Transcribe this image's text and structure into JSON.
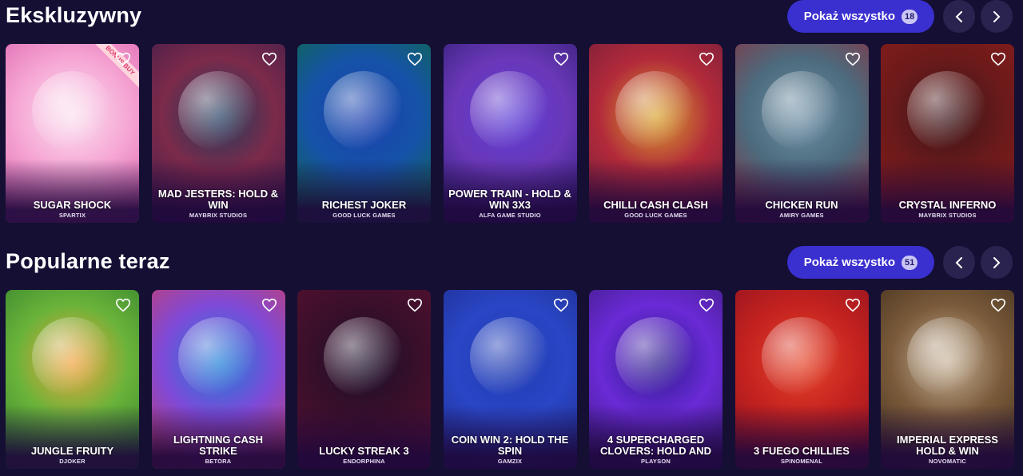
{
  "sections": [
    {
      "title": "Ekskluzywny",
      "show_all_label": "Pokaż wszystko",
      "count": "18",
      "games": [
        {
          "title": "SUGAR SHOCK",
          "provider": "SPARTIX",
          "badge": "BONUS BUY",
          "colors": [
            "#fbe1f0",
            "#f6a6d4",
            "#d85aa8"
          ]
        },
        {
          "title": "MAD JESTERS: HOLD & WIN",
          "provider": "MAYBRIX STUDIOS",
          "colors": [
            "#1e3d5e",
            "#7c2a4a",
            "#3a1b4a"
          ]
        },
        {
          "title": "RICHEST JOKER",
          "provider": "GOOD LUCK GAMES",
          "colors": [
            "#1b3fb0",
            "#1553a8",
            "#0e6b3a"
          ]
        },
        {
          "title": "POWER TRAIN - HOLD & WIN 3X3",
          "provider": "ALFA GAME STUDIO",
          "colors": [
            "#5b3bd6",
            "#6a38b8",
            "#2a1a6b"
          ]
        },
        {
          "title": "CHILLI CASH CLASH",
          "provider": "GOOD LUCK GAMES",
          "colors": [
            "#d9a52e",
            "#b22a3a",
            "#6a1b3a"
          ]
        },
        {
          "title": "CHICKEN RUN",
          "provider": "AMIRY GAMES",
          "colors": [
            "#6e8fa6",
            "#4c6b7d",
            "#8d2a3a"
          ]
        },
        {
          "title": "CRYSTAL INFERNO",
          "provider": "MAYBRIX STUDIOS",
          "colors": [
            "#3a1518",
            "#6a1a1a",
            "#8e1c1c"
          ]
        }
      ]
    },
    {
      "title": "Popularne teraz",
      "show_all_label": "Pokaż wszystko",
      "count": "51",
      "games": [
        {
          "title": "JUNGLE FRUITY",
          "provider": "DJOKER",
          "colors": [
            "#f3a23c",
            "#6ab33a",
            "#2b7a2b"
          ]
        },
        {
          "title": "LIGHTNING CASH STRIKE",
          "provider": "BETORA",
          "colors": [
            "#1a7fd6",
            "#7f4ad8",
            "#d23b5a"
          ]
        },
        {
          "title": "LUCKY STREAK 3",
          "provider": "ENDORPHINA",
          "colors": [
            "#1a0f2a",
            "#3a0f2a",
            "#5a1030"
          ]
        },
        {
          "title": "COIN WIN 2: HOLD THE SPIN",
          "provider": "GAMZIX",
          "colors": [
            "#1e3ab0",
            "#2a46c6",
            "#1c2b8a"
          ]
        },
        {
          "title": "4 SUPERCHARGED CLOVERS: HOLD AND",
          "provider": "PLAYSON",
          "colors": [
            "#2a1a8a",
            "#6a2ad6",
            "#3a1a7a"
          ]
        },
        {
          "title": "3 FUEGO CHILLIES",
          "provider": "SPINOMENAL",
          "colors": [
            "#e6452a",
            "#c4221f",
            "#8a1020"
          ]
        },
        {
          "title": "IMPERIAL EXPRESS HOLD & WIN",
          "provider": "NOVOMATIC",
          "colors": [
            "#c8b49a",
            "#7a5a3a",
            "#3a2a1a"
          ]
        }
      ]
    }
  ]
}
